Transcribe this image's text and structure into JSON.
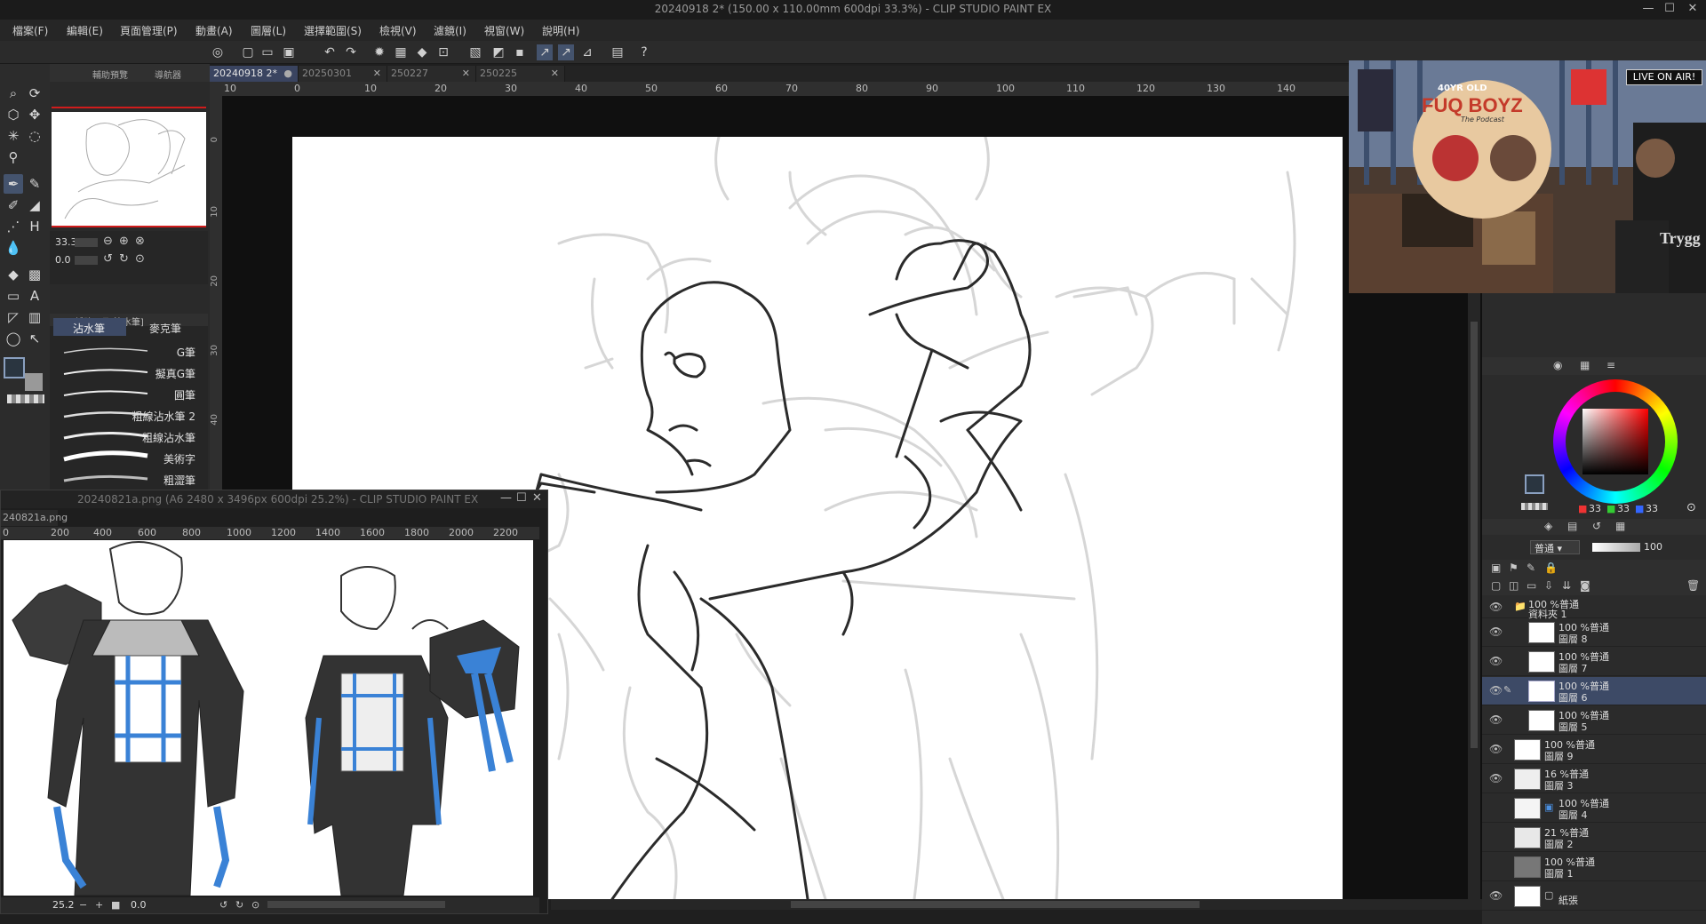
{
  "window": {
    "title": "20240918 2* (150.00 x 110.00mm 600dpi 33.3%) - CLIP STUDIO PAINT EX",
    "minimize": "—",
    "maximize": "☐",
    "close": "✕"
  },
  "menu": [
    "檔案(F)",
    "編輯(E)",
    "頁面管理(P)",
    "動畫(A)",
    "圖層(L)",
    "選擇範圍(S)",
    "檢視(V)",
    "濾鏡(I)",
    "視窗(W)",
    "說明(H)"
  ],
  "navigator": {
    "tabs": [
      "輔助預覽",
      "導航器"
    ],
    "zoom": "33.3",
    "angle": "0.0"
  },
  "subtool": {
    "header": "輔助工具[沾水筆]",
    "tabs": [
      "沾水筆",
      "麥克筆"
    ],
    "brushes": [
      "G筆",
      "擬真G筆",
      "圓筆",
      "粗線沾水筆 2",
      "粗線沾水筆",
      "美術字",
      "粗澀筆"
    ]
  },
  "doc_tabs": [
    "20240918 2*",
    "20250301",
    "250227",
    "250225"
  ],
  "ruler_h": [
    "10",
    "0",
    "10",
    "20",
    "30",
    "40",
    "50",
    "60",
    "70",
    "80",
    "90",
    "100",
    "110",
    "120",
    "130",
    "140"
  ],
  "ruler_v": [
    "0",
    "10",
    "20",
    "30",
    "40"
  ],
  "subwindow": {
    "title": "20240821a.png (A6 2480 x 3496px 600dpi 25.2%) - CLIP STUDIO PAINT EX",
    "tab": "240821a.png",
    "ruler": [
      "0",
      "200",
      "400",
      "600",
      "800",
      "1000",
      "1200",
      "1400",
      "1600",
      "1800",
      "2000",
      "2200"
    ],
    "zoom": "25.2",
    "angle": "0.0"
  },
  "video": {
    "sign": "LIVE ON AIR!",
    "logo_top": "40YR OLD",
    "logo_main": "FUQ BOYZ",
    "logo_sub": "The Podcast",
    "shirt": "Trygg"
  },
  "color": {
    "r": "33",
    "g": "33",
    "b": "33",
    "accent": "#3d4a66"
  },
  "layer_panel": {
    "blend": "普通",
    "opacity": "100",
    "layers": [
      {
        "line1": "100 %普通",
        "line2": "資料夾 1",
        "type": "folder"
      },
      {
        "line1": "100 %普通",
        "line2": "圖層 8",
        "type": "child"
      },
      {
        "line1": "100 %普通",
        "line2": "圖層 7",
        "type": "child"
      },
      {
        "line1": "100 %普通",
        "line2": "圖層 6",
        "type": "child",
        "selected": true
      },
      {
        "line1": "100 %普通",
        "line2": "圖層 5",
        "type": "child"
      },
      {
        "line1": "100 %普通",
        "line2": "圖層 9",
        "type": "layer"
      },
      {
        "line1": "16 %普通",
        "line2": "圖層 3",
        "type": "layer"
      },
      {
        "line1": "100 %普通",
        "line2": "圖層 4",
        "type": "layer"
      },
      {
        "line1": "21 %普通",
        "line2": "圖層 2",
        "type": "layer"
      },
      {
        "line1": "100 %普通",
        "line2": "圖層 1",
        "type": "layer"
      },
      {
        "line1": "",
        "line2": "紙張",
        "type": "paper"
      }
    ]
  }
}
